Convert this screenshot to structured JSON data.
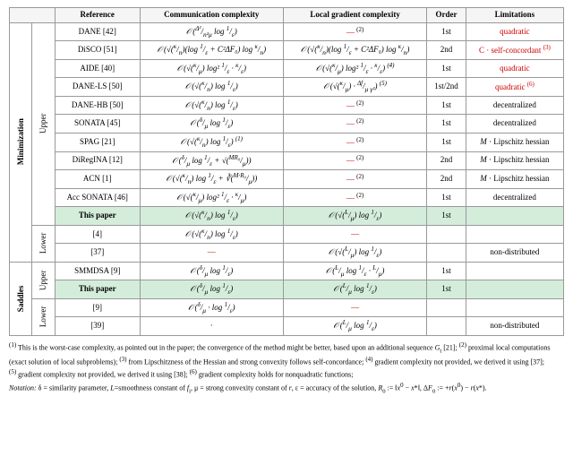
{
  "table": {
    "headers": [
      "Reference",
      "Communication complexity",
      "Local gradient complexity",
      "Order",
      "Limitations"
    ],
    "sections": [
      {
        "section": "Minimization",
        "subsections": [
          {
            "label": "Upper",
            "rows": [
              {
                "ref": "DANE [42]",
                "comm": "𝒪(Δ²ₙₛ/n²μ · log 1/ε)",
                "local": "— (2)",
                "order": "1st",
                "limit": "quadratic",
                "highlight": false
              },
              {
                "ref": "DiSCO [51]",
                "comm": "𝒪(√(κ/n)(log 1/ε + C²ΔF₀) log κ/n)",
                "local": "𝒪(√(κ/n)(log 1/ε + C²ΔF₀) log κ/n)",
                "order": "2nd",
                "limit": "C · self-concordant (3)",
                "highlight": false
              },
              {
                "ref": "AIDE [40]",
                "comm": "𝒪(√(κ/μ) log² 1/ε · κ/ε)",
                "local": "𝒪(√(κ/μ) log² 1/ε · κ/ε) (4)",
                "order": "1st",
                "limit": "quadratic",
                "highlight": false
              },
              {
                "ref": "DANE-LS [50]",
                "comm": "𝒪(√(κ/n) log 1/ε)",
                "local": "𝒪(√(κ/μ) · Δf/μ · γ²) (5)",
                "order": "1st/2nd",
                "limit": "quadratic (6)",
                "highlight": false
              },
              {
                "ref": "DANE-HB [50]",
                "comm": "𝒪(√(κ/n) log 1/ε)",
                "local": "— (2)",
                "order": "1st",
                "limit": "decentralized",
                "highlight": false
              },
              {
                "ref": "SONATA [45]",
                "comm": "𝒪(δ/μ log 1/ε)",
                "local": "— (2)",
                "order": "1st",
                "limit": "decentralized",
                "highlight": false
              },
              {
                "ref": "SPAG [21]",
                "comm": "𝒪(√(κ/n) log 1/ε) (1)",
                "local": "— (2)",
                "order": "1st",
                "limit": "M · Lipschitz hessian",
                "highlight": false
              },
              {
                "ref": "DiRegINA [12]",
                "comm": "𝒪(δ/μ log 1/ε + √(MRₒ/μ))",
                "local": "— (2)",
                "order": "2nd",
                "limit": "M · Lipschitz hessian",
                "highlight": false
              },
              {
                "ref": "ACN [1]",
                "comm": "𝒪(√(κ/n) log 1/ε + ∛(M·R₀/μ))",
                "local": "— (2)",
                "order": "2nd",
                "limit": "M · Lipschitz hessian",
                "highlight": false
              },
              {
                "ref": "Acc SONATA [46]",
                "comm": "𝒪(√(κ/μ) log² 1/ε · κ/μ)",
                "local": "— (2)",
                "order": "1st",
                "limit": "decentralized",
                "highlight": false
              },
              {
                "ref": "This paper",
                "comm": "𝒪(√(κ/n) log 1/ε)",
                "local": "𝒪(√(L/μ) log 1/ε)",
                "order": "1st",
                "limit": "",
                "highlight": true
              }
            ]
          },
          {
            "label": "Lower",
            "rows": [
              {
                "ref": "[4]",
                "comm": "𝒪(√(κ/n) log 1/ε)",
                "local": "—",
                "order": "",
                "limit": "",
                "highlight": false
              },
              {
                "ref": "[37]",
                "comm": "—",
                "local": "𝒪(√(L/μ) log 1/ε)",
                "order": "",
                "limit": "non-distributed",
                "highlight": false
              }
            ]
          }
        ]
      },
      {
        "section": "Saddles",
        "subsections": [
          {
            "label": "Upper",
            "rows": [
              {
                "ref": "SMMDSA [9]",
                "comm": "𝒪(δ/μ log 1/ε)",
                "local": "𝒪(L/μ log 1/ε · L/μ)",
                "order": "1st",
                "limit": "",
                "highlight": false
              },
              {
                "ref": "This paper",
                "comm": "𝒪(δ/μ log 1/ε)",
                "local": "𝒪(L/μ log 1/ε)",
                "order": "1st",
                "limit": "",
                "highlight": true
              }
            ]
          },
          {
            "label": "Lower",
            "rows": [
              {
                "ref": "[9]",
                "comm": "𝒪(δ/μ · log 1/ε)",
                "local": "—",
                "order": "",
                "limit": "",
                "highlight": false
              },
              {
                "ref": "[39]",
                "comm": "·",
                "local": "𝒪(L/μ log 1/ε)",
                "order": "",
                "limit": "non-distributed",
                "highlight": false
              }
            ]
          }
        ]
      }
    ]
  },
  "footnotes": [
    "(1) This is the worst-case complexity, as pointed out in the paper; the convergence of the method might be better, based upon an additional sequence Gₜ [21];",
    "(2) proximal local computations (exact solution of local subproblems);",
    "(3) from Lipschitzness of the Hessian and strong convexity follows self-concordance;",
    "(4) gradient complexity not provided, we derived it using [37];",
    "(5) gradient complexity not provided, we derived it using [38];",
    "(6) gradient complexity holds for nonquadratic functions;",
    "Notation: δ = similarity parameter, L=smoothness constant of fᵢ, μ = strong convexity constant of r, ε = accuracy of the solution, R₀ := ‖x⁰ − x*‖, ΔF₀ := +r(x⁰) − r(x*)."
  ]
}
